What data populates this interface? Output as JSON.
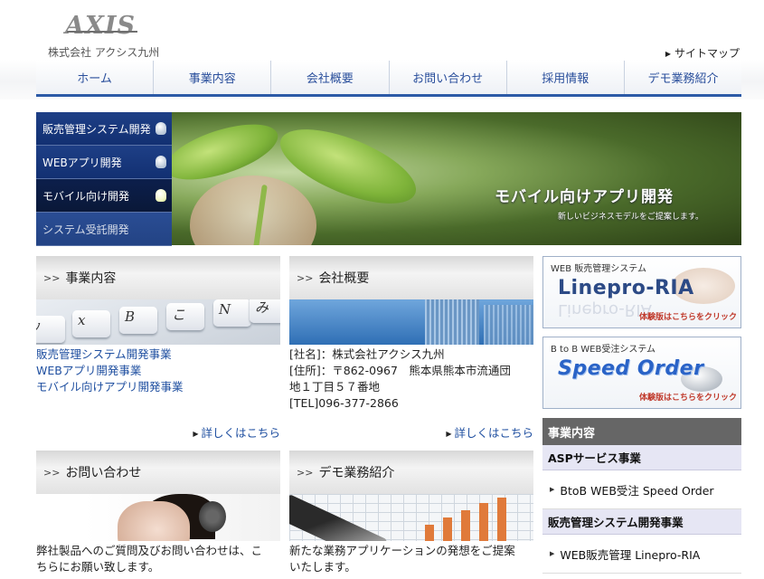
{
  "header": {
    "logo_text": "AXIS",
    "company_name": "株式会社 アクシス九州",
    "sitemap_label": "サイトマップ"
  },
  "nav": {
    "items": [
      {
        "label": "ホーム"
      },
      {
        "label": "事業内容"
      },
      {
        "label": "会社概要"
      },
      {
        "label": "お問い合わせ"
      },
      {
        "label": "採用情報"
      },
      {
        "label": "デモ業務紹介"
      }
    ]
  },
  "hero": {
    "side_items": [
      {
        "label": "販売管理システム開発"
      },
      {
        "label": "WEBアプリ開発"
      },
      {
        "label": "モバイル向け開発"
      },
      {
        "label": "システム受託開発"
      }
    ],
    "active_index": 2,
    "title": "モバイル向けアプリ開発",
    "subtitle": "新しいビジネスモデルをご提案します。"
  },
  "boxes": {
    "business": {
      "title": "事業内容",
      "links": [
        "販売管理システム開発事業",
        "WEBアプリ開発事業",
        "モバイル向けアプリ開発事業"
      ],
      "more": "詳しくはこちら"
    },
    "company": {
      "title": "会社概要",
      "lines": [
        "[社名]：株式会社アクシス九州",
        "[住所]：〒862-0967　熊本県熊本市流通団",
        "地１丁目５７番地",
        "[TEL]096-377-2866"
      ],
      "more": "詳しくはこちら"
    },
    "contact": {
      "title": "お問い合わせ",
      "lines": [
        "弊社製品へのご質問及びお問い合わせは、こ",
        "ちらにお願い致します。"
      ]
    },
    "demo": {
      "title": "デモ業務紹介",
      "lines": [
        "新たな業務アプリケーションの発想をご提案",
        "いたします。"
      ]
    }
  },
  "banners": {
    "linepro": {
      "caption": "WEB 販売管理システム",
      "name": "Linepro-RIA",
      "try": "体験版はこちらをクリック"
    },
    "speedorder": {
      "caption": "B to B WEB受注システム",
      "name": "Speed Order",
      "try": "体験版はこちらをクリック"
    }
  },
  "business_menu": {
    "title": "事業内容",
    "sections": [
      {
        "heading": "ASPサービス事業",
        "link": "BtoB WEB受注 Speed Order"
      },
      {
        "heading": "販売管理システム開発事業",
        "link": "WEB販売管理 Linepro-RIA"
      }
    ]
  }
}
